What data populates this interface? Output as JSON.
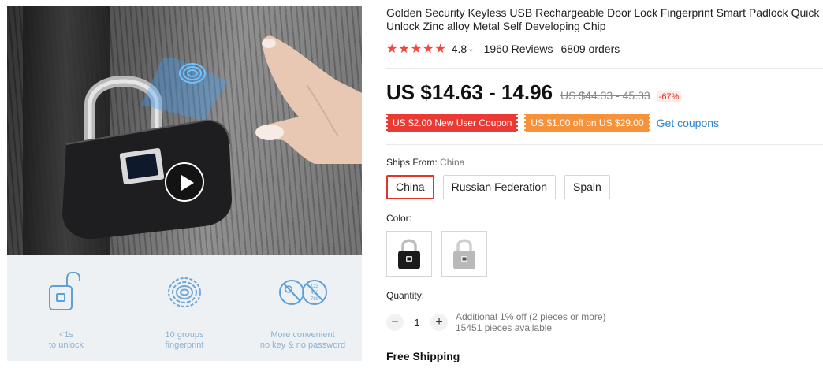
{
  "product": {
    "title": "Golden Security Keyless USB Rechargeable Door Lock Fingerprint Smart Padlock Quick Unlock Zinc alloy Metal Self Developing Chip",
    "stars": "★★★★★",
    "rating": "4.8",
    "rating_chevron": "⌄",
    "reviews": "1960 Reviews",
    "orders": "6809 orders"
  },
  "price": {
    "current": "US $14.63 - 14.96",
    "original": "US $44.33 - 45.33",
    "discount": "-67%"
  },
  "coupons": {
    "new_user": "US $2.00 New User Coupon",
    "store": "US $1.00 off on US $29.00",
    "get_label": "Get coupons"
  },
  "ships_from": {
    "label": "Ships From:",
    "selected": "China",
    "options": [
      "China",
      "Russian Federation",
      "Spain"
    ]
  },
  "color": {
    "label": "Color:",
    "options": [
      "black",
      "silver"
    ]
  },
  "quantity": {
    "label": "Quantity:",
    "minus": "−",
    "plus": "+",
    "value": "1",
    "note_line1": "Additional 1% off (2 pieces or more)",
    "note_line2": "15451 pieces available"
  },
  "shipping": {
    "label": "Free Shipping"
  },
  "features": [
    {
      "icon": "unlock-icon",
      "line1": "<1s",
      "line2": "to unlock"
    },
    {
      "icon": "fingerprint-icon",
      "line1": "10 groups",
      "line2": "fingerprint"
    },
    {
      "icon": "no-key-icon",
      "line1": "More convenient",
      "line2": "no key & no password"
    }
  ],
  "feature_icon_text": "123\n456\n789",
  "colors": {
    "accent": "#e0352b",
    "link": "#2e83c9",
    "coupon_red": "#ea3a34",
    "coupon_orange": "#f5923a",
    "feature_blue": "#8ab2d6"
  }
}
